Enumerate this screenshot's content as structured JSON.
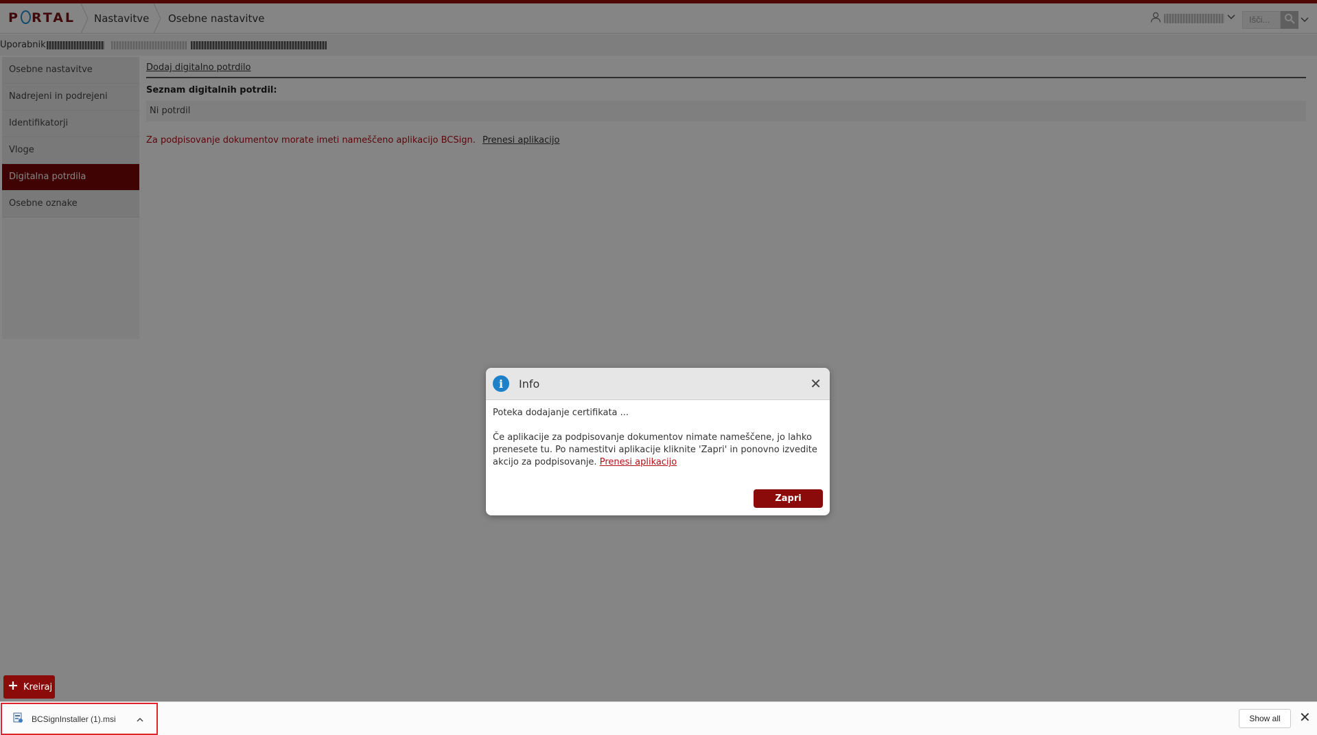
{
  "header": {
    "logo_text": "PORTAL",
    "breadcrumbs": [
      "Nastavitve",
      "Osebne nastavitve"
    ],
    "search_placeholder": "Išči..."
  },
  "user_bar": {
    "label": "Uporabnik:"
  },
  "sidebar": {
    "items": [
      {
        "label": "Osebne nastavitve",
        "active": false
      },
      {
        "label": "Nadrejeni in podrejeni",
        "active": false
      },
      {
        "label": "Identifikatorji",
        "active": false
      },
      {
        "label": "Vloge",
        "active": false
      },
      {
        "label": "Digitalna potrdila",
        "active": true
      },
      {
        "label": "Osebne oznake",
        "active": false
      }
    ]
  },
  "main": {
    "add_link": "Dodaj digitalno potrdilo",
    "list_title": "Seznam digitalnih potrdil:",
    "empty_text": "Ni potrdil",
    "warning_text": "Za podpisovanje dokumentov morate imeti nameščeno aplikacijo BCSign.",
    "warning_link": "Prenesi aplikacijo"
  },
  "create_button": {
    "label": "Kreiraj"
  },
  "dialog": {
    "title": "Info",
    "line1": "Poteka dodajanje certifikata ...",
    "line2": "Če aplikacije za podpisovanje dokumentov nimate nameščene, jo lahko prenesete tu. Po namestitvi aplikacije kliknite 'Zapri' in ponovno izvedite akcijo za podpisovanje.",
    "link": "Prenesi aplikacijo",
    "button_label": "Zapri"
  },
  "download_bar": {
    "file_name": "BCSignInstaller (1).msi",
    "show_all": "Show all"
  },
  "colors": {
    "accent": "#8b0a0a",
    "active_sidebar": "#7c0606",
    "warning": "#b20f16",
    "info_icon": "#1e80c9"
  },
  "icons": [
    "chevron-right-icon",
    "user-icon",
    "chevron-down-icon",
    "search-icon",
    "plus-icon",
    "info-icon",
    "close-icon",
    "msi-file-icon",
    "chevron-up-icon"
  ]
}
